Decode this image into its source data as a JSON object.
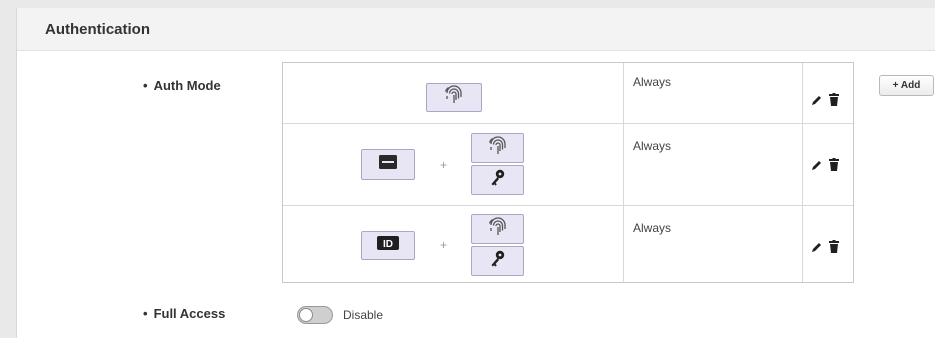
{
  "panel": {
    "title": "Authentication"
  },
  "fields": {
    "auth_mode": {
      "label": "Auth Mode"
    },
    "full_access": {
      "label": "Full Access",
      "value": "Disable",
      "enabled": false
    }
  },
  "add_button": {
    "label": "+ Add"
  },
  "auth_modes": [
    {
      "credentials": [
        "fingerprint-icon"
      ],
      "schedule": "Always"
    },
    {
      "credentials": [
        "card-icon",
        "fingerprint-icon",
        "key-icon"
      ],
      "schedule": "Always"
    },
    {
      "credentials": [
        "id-icon",
        "fingerprint-icon",
        "key-icon"
      ],
      "schedule": "Always"
    }
  ],
  "plus_symbol": "+",
  "id_icon_text": "ID",
  "bullet": "•",
  "colors": {
    "credential_bg": "#e8e6f5",
    "credential_border": "#a9a7c4",
    "icon_dark": "#1f1f1f"
  }
}
